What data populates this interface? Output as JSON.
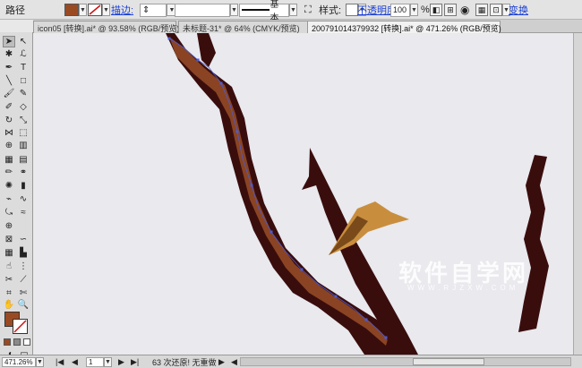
{
  "control_bar": {
    "mode_label": "路径",
    "stroke_label": "描边:",
    "stroke_style": "基本",
    "style_label": "样式:",
    "opacity_label": "不透明度:",
    "opacity_value": "100",
    "opacity_unit": "%",
    "transform_label": "变换",
    "fill_color": "#9a4a23",
    "stroke_color": "#ffffff"
  },
  "tabs": [
    {
      "label": "icon05 [转换].ai* @ 93.58% (RGB/预览)"
    },
    {
      "label": "未标题-31* @ 64% (CMYK/预览)"
    },
    {
      "label": "20079101437​9932 [转换].ai* @ 471.26% (RGB/预览)"
    }
  ],
  "canvas": {
    "watermark": "软件自学网",
    "watermark_sub": "WWW.RJZXW.COM",
    "colors": {
      "branch_dark": "#3a0d0d",
      "branch_brown": "#8a4423",
      "branch_highlight": "#b55a30",
      "leaf_gold": "#c98e3d",
      "leaf_dark": "#7a4a1a",
      "path_blue": "#4a5bd6"
    }
  },
  "status_bar": {
    "zoom": "471.26%",
    "page": "1",
    "message": "63 次还原! 无重做"
  }
}
